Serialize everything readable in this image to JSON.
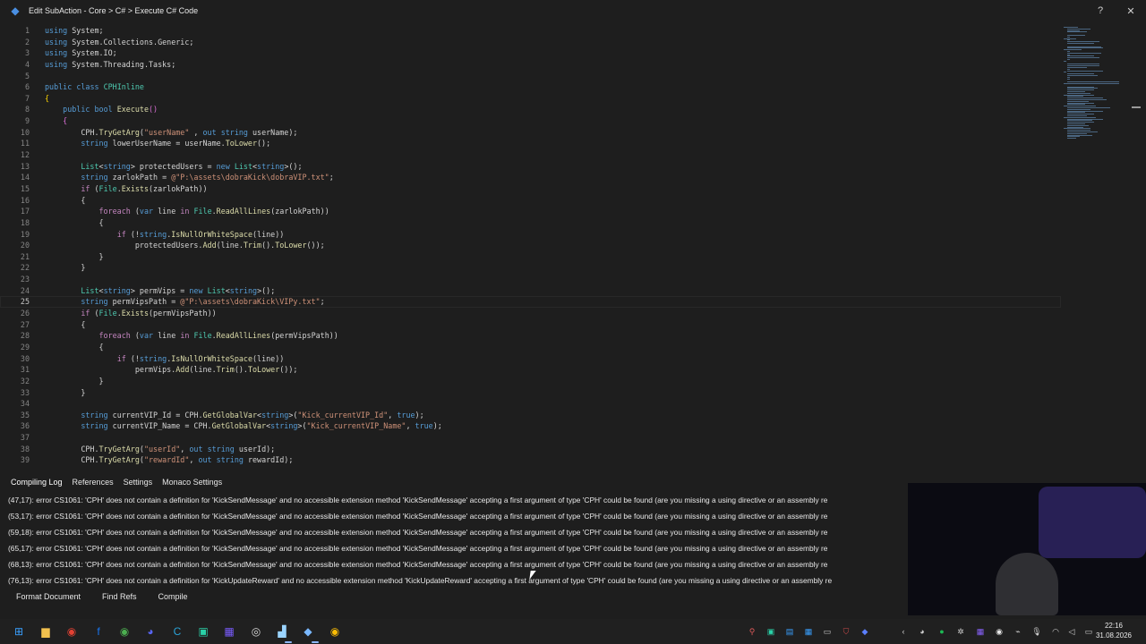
{
  "window": {
    "title": "Edit SubAction - Core > C# > Execute C# Code",
    "help_label": "?",
    "close_label": "✕"
  },
  "editor": {
    "current_line": 25,
    "lines": [
      {
        "n": "1",
        "tokens": [
          [
            "kw",
            "using"
          ],
          [
            "",
            "System;"
          ]
        ]
      },
      {
        "n": "2",
        "tokens": [
          [
            "kw",
            "using"
          ],
          [
            "",
            "System.Collections.Generic;"
          ]
        ]
      },
      {
        "n": "3",
        "tokens": [
          [
            "kw",
            "using"
          ],
          [
            "",
            "System.IO;"
          ]
        ]
      },
      {
        "n": "4",
        "tokens": [
          [
            "kw",
            "using"
          ],
          [
            "",
            "System.Threading.Tasks;"
          ]
        ]
      },
      {
        "n": "5",
        "tokens": []
      },
      {
        "n": "6",
        "tokens": [
          [
            "kw",
            "public"
          ],
          [
            "kw",
            "class"
          ],
          [
            "ty",
            "CPHInline"
          ]
        ]
      },
      {
        "n": "7",
        "tokens": [
          [
            "br",
            "{"
          ]
        ]
      },
      {
        "n": "8",
        "tokens": [
          [
            "",
            "    "
          ],
          [
            "kw",
            "public"
          ],
          [
            "kw",
            "bool"
          ],
          [
            "fn",
            "Execute"
          ],
          [
            "br2",
            "()"
          ]
        ]
      },
      {
        "n": "9",
        "tokens": [
          [
            "",
            "    "
          ],
          [
            "br2",
            "{"
          ]
        ]
      },
      {
        "n": "10",
        "tokens": [
          [
            "",
            "        CPH."
          ],
          [
            "fn",
            "TryGetArg"
          ],
          [
            "",
            "("
          ],
          [
            "st",
            "\"userName\""
          ],
          [
            "",
            " , "
          ],
          [
            "kw",
            "out"
          ],
          [
            "kw",
            "string"
          ],
          [
            "",
            "userName);"
          ]
        ]
      },
      {
        "n": "11",
        "tokens": [
          [
            "",
            "        "
          ],
          [
            "kw",
            "string"
          ],
          [
            "",
            "lowerUserName = userName."
          ],
          [
            "fn",
            "ToLower"
          ],
          [
            "",
            "();"
          ]
        ]
      },
      {
        "n": "12",
        "tokens": []
      },
      {
        "n": "13",
        "tokens": [
          [
            "",
            "        "
          ],
          [
            "ty",
            "List"
          ],
          [
            "",
            "<"
          ],
          [
            "kw",
            "string"
          ],
          [
            "",
            "> protectedUsers = "
          ],
          [
            "kw",
            "new"
          ],
          [
            "ty",
            "List"
          ],
          [
            "",
            "<"
          ],
          [
            "kw",
            "string"
          ],
          [
            "",
            ">();"
          ]
        ]
      },
      {
        "n": "14",
        "tokens": [
          [
            "",
            "        "
          ],
          [
            "kw",
            "string"
          ],
          [
            "",
            "zarlokPath = "
          ],
          [
            "st",
            "@\"P:\\assets\\dobraKick\\dobraVIP.txt\""
          ],
          [
            "",
            ";"
          ]
        ]
      },
      {
        "n": "15",
        "tokens": [
          [
            "",
            "        "
          ],
          [
            "cf",
            "if"
          ],
          [
            "",
            ""
          ],
          [
            "",
            "("
          ],
          [
            "ty",
            "File"
          ],
          [
            "",
            "."
          ],
          [
            "fn",
            "Exists"
          ],
          [
            "",
            "(zarlokPath))"
          ]
        ]
      },
      {
        "n": "16",
        "tokens": [
          [
            "",
            "        {"
          ]
        ]
      },
      {
        "n": "17",
        "tokens": [
          [
            "",
            "            "
          ],
          [
            "cf",
            "foreach"
          ],
          [
            "",
            ""
          ],
          [
            "",
            "("
          ],
          [
            "kw",
            "var"
          ],
          [
            "",
            "line "
          ],
          [
            "cf",
            "in"
          ],
          [
            "ty",
            "File"
          ],
          [
            "",
            "."
          ],
          [
            "fn",
            "ReadAllLines"
          ],
          [
            "",
            "(zarlokPath))"
          ]
        ]
      },
      {
        "n": "18",
        "tokens": [
          [
            "",
            "            {"
          ]
        ]
      },
      {
        "n": "19",
        "tokens": [
          [
            "",
            "                "
          ],
          [
            "cf",
            "if"
          ],
          [
            "",
            ""
          ],
          [
            "",
            "(!"
          ],
          [
            "kw",
            "string"
          ],
          [
            "",
            "."
          ],
          [
            "fn",
            "IsNullOrWhiteSpace"
          ],
          [
            "",
            "(line))"
          ]
        ]
      },
      {
        "n": "20",
        "tokens": [
          [
            "",
            "                    protectedUsers."
          ],
          [
            "fn",
            "Add"
          ],
          [
            "",
            "(line."
          ],
          [
            "fn",
            "Trim"
          ],
          [
            "",
            "()."
          ],
          [
            "fn",
            "ToLower"
          ],
          [
            "",
            "());"
          ]
        ]
      },
      {
        "n": "21",
        "tokens": [
          [
            "",
            "            }"
          ]
        ]
      },
      {
        "n": "22",
        "tokens": [
          [
            "",
            "        }"
          ]
        ]
      },
      {
        "n": "23",
        "tokens": []
      },
      {
        "n": "24",
        "tokens": [
          [
            "",
            "        "
          ],
          [
            "ty",
            "List"
          ],
          [
            "",
            "<"
          ],
          [
            "kw",
            "string"
          ],
          [
            "",
            "> permVips = "
          ],
          [
            "kw",
            "new"
          ],
          [
            "ty",
            "List"
          ],
          [
            "",
            "<"
          ],
          [
            "kw",
            "string"
          ],
          [
            "",
            ">();"
          ]
        ]
      },
      {
        "n": "25",
        "tokens": [
          [
            "",
            "        "
          ],
          [
            "kw",
            "string"
          ],
          [
            "",
            "permVipsPath = "
          ],
          [
            "st",
            "@\"P:\\assets\\dobraKick\\VIPy.txt\""
          ],
          [
            "",
            ";"
          ]
        ]
      },
      {
        "n": "26",
        "tokens": [
          [
            "",
            "        "
          ],
          [
            "cf",
            "if"
          ],
          [
            "",
            ""
          ],
          [
            "",
            "("
          ],
          [
            "ty",
            "File"
          ],
          [
            "",
            "."
          ],
          [
            "fn",
            "Exists"
          ],
          [
            "",
            "(permVipsPath))"
          ]
        ]
      },
      {
        "n": "27",
        "tokens": [
          [
            "",
            "        {"
          ]
        ]
      },
      {
        "n": "28",
        "tokens": [
          [
            "",
            "            "
          ],
          [
            "cf",
            "foreach"
          ],
          [
            "",
            ""
          ],
          [
            "",
            "("
          ],
          [
            "kw",
            "var"
          ],
          [
            "",
            "line "
          ],
          [
            "cf",
            "in"
          ],
          [
            "ty",
            "File"
          ],
          [
            "",
            "."
          ],
          [
            "fn",
            "ReadAllLines"
          ],
          [
            "",
            "(permVipsPath))"
          ]
        ]
      },
      {
        "n": "29",
        "tokens": [
          [
            "",
            "            {"
          ]
        ]
      },
      {
        "n": "30",
        "tokens": [
          [
            "",
            "                "
          ],
          [
            "cf",
            "if"
          ],
          [
            "",
            ""
          ],
          [
            "",
            "(!"
          ],
          [
            "kw",
            "string"
          ],
          [
            "",
            "."
          ],
          [
            "fn",
            "IsNullOrWhiteSpace"
          ],
          [
            "",
            "(line))"
          ]
        ]
      },
      {
        "n": "31",
        "tokens": [
          [
            "",
            "                    permVips."
          ],
          [
            "fn",
            "Add"
          ],
          [
            "",
            "(line."
          ],
          [
            "fn",
            "Trim"
          ],
          [
            "",
            "()."
          ],
          [
            "fn",
            "ToLower"
          ],
          [
            "",
            "());"
          ]
        ]
      },
      {
        "n": "32",
        "tokens": [
          [
            "",
            "            }"
          ]
        ]
      },
      {
        "n": "33",
        "tokens": [
          [
            "",
            "        }"
          ]
        ]
      },
      {
        "n": "34",
        "tokens": []
      },
      {
        "n": "35",
        "tokens": [
          [
            "",
            "        "
          ],
          [
            "kw",
            "string"
          ],
          [
            "",
            "currentVIP_Id = CPH."
          ],
          [
            "fn",
            "GetGlobalVar"
          ],
          [
            "",
            "<"
          ],
          [
            "kw",
            "string"
          ],
          [
            "",
            ">("
          ],
          [
            "st",
            "\"Kick_currentVIP_Id\""
          ],
          [
            "",
            ", "
          ],
          [
            "kw",
            "true"
          ],
          [
            "",
            ");"
          ]
        ]
      },
      {
        "n": "36",
        "tokens": [
          [
            "",
            "        "
          ],
          [
            "kw",
            "string"
          ],
          [
            "",
            "currentVIP_Name = CPH."
          ],
          [
            "fn",
            "GetGlobalVar"
          ],
          [
            "",
            "<"
          ],
          [
            "kw",
            "string"
          ],
          [
            "",
            ">("
          ],
          [
            "st",
            "\"Kick_currentVIP_Name\""
          ],
          [
            "",
            ", "
          ],
          [
            "kw",
            "true"
          ],
          [
            "",
            ");"
          ]
        ]
      },
      {
        "n": "37",
        "tokens": []
      },
      {
        "n": "38",
        "tokens": [
          [
            "",
            "        CPH."
          ],
          [
            "fn",
            "TryGetArg"
          ],
          [
            "",
            "("
          ],
          [
            "st",
            "\"userId\""
          ],
          [
            "",
            ", "
          ],
          [
            "kw",
            "out"
          ],
          [
            "kw",
            "string"
          ],
          [
            "",
            "userId);"
          ]
        ]
      },
      {
        "n": "39",
        "tokens": [
          [
            "",
            "        CPH."
          ],
          [
            "fn",
            "TryGetArg"
          ],
          [
            "",
            "("
          ],
          [
            "st",
            "\"rewardId\""
          ],
          [
            "",
            ", "
          ],
          [
            "kw",
            "out"
          ],
          [
            "kw",
            "string"
          ],
          [
            "",
            "rewardId);"
          ]
        ]
      }
    ]
  },
  "panel": {
    "tabs": [
      "Compiling Log",
      "References",
      "Settings",
      "Monaco Settings"
    ],
    "log": [
      "(47,17): error CS1061: 'CPH' does not contain a definition for 'KickSendMessage' and no accessible extension method 'KickSendMessage' accepting a first argument of type 'CPH' could be found (are you missing a using directive or an assembly re",
      "(53,17): error CS1061: 'CPH' does not contain a definition for 'KickSendMessage' and no accessible extension method 'KickSendMessage' accepting a first argument of type 'CPH' could be found (are you missing a using directive or an assembly re",
      "(59,18): error CS1061: 'CPH' does not contain a definition for 'KickSendMessage' and no accessible extension method 'KickSendMessage' accepting a first argument of type 'CPH' could be found (are you missing a using directive or an assembly re",
      "(65,17): error CS1061: 'CPH' does not contain a definition for 'KickSendMessage' and no accessible extension method 'KickSendMessage' accepting a first argument of type 'CPH' could be found (are you missing a using directive or an assembly re",
      "(68,13): error CS1061: 'CPH' does not contain a definition for 'KickSendMessage' and no accessible extension method 'KickSendMessage' accepting a first argument of type 'CPH' could be found (are you missing a using directive or an assembly re",
      "(76,13): error CS1061: 'CPH' does not contain a definition for 'KickUpdateReward' and no accessible extension method 'KickUpdateReward' accepting a first argument of type 'CPH' could be found (are you missing a using directive or an assembly re"
    ],
    "actions": [
      "Format Document",
      "Find Refs",
      "Compile"
    ]
  },
  "taskbar": {
    "items": [
      {
        "name": "windows-start-icon",
        "glyph": "⊞",
        "color": "#3aa0ff"
      },
      {
        "name": "file-explorer-icon",
        "glyph": "▆",
        "color": "#f2c14e"
      },
      {
        "name": "chrome-icon",
        "glyph": "◉",
        "color": "#e34133"
      },
      {
        "name": "facebook-icon",
        "glyph": "f",
        "color": "#1877f2"
      },
      {
        "name": "chrome-profile-icon",
        "glyph": "◉",
        "color": "#4caf50"
      },
      {
        "name": "discord-icon",
        "glyph": "◕",
        "color": "#5865f2"
      },
      {
        "name": "ccleaner-icon",
        "glyph": "C",
        "color": "#2aa3d8"
      },
      {
        "name": "editor-app-icon",
        "glyph": "▣",
        "color": "#2ad1a8"
      },
      {
        "name": "grid-app-icon",
        "glyph": "▦",
        "color": "#7a5cff"
      },
      {
        "name": "obs-icon",
        "glyph": "◎",
        "color": "#d9d9d9"
      },
      {
        "name": "streamerbot-icon",
        "glyph": "▟",
        "color": "#9ad4ff"
      },
      {
        "name": "streamerbot-active-icon",
        "glyph": "◆",
        "color": "#7ab8ff"
      },
      {
        "name": "chrome-alt-icon",
        "glyph": "◉",
        "color": "#fbbc05"
      }
    ],
    "tray": [
      {
        "name": "location-icon",
        "glyph": "⚲",
        "color": "#e05a5a"
      },
      {
        "name": "tray-app-icon-1",
        "glyph": "▣",
        "color": "#2ad1a8"
      },
      {
        "name": "tray-app-icon-2",
        "glyph": "▤",
        "color": "#39a0ff"
      },
      {
        "name": "tray-app-icon-3",
        "glyph": "▦",
        "color": "#39a0ff"
      },
      {
        "name": "tray-app-icon-4",
        "glyph": "▭",
        "color": "#cfcfcf"
      },
      {
        "name": "tray-shield-icon",
        "glyph": "⛉",
        "color": "#d24b4b"
      },
      {
        "name": "tray-app-icon-5",
        "glyph": "◆",
        "color": "#5b7fff"
      },
      {
        "name": "tray-arrow-icon",
        "glyph": "‹",
        "color": "#cfcfcf"
      },
      {
        "name": "tray-discord-icon",
        "glyph": "◕",
        "color": "#cfcfcf"
      },
      {
        "name": "spotify-icon",
        "glyph": "●",
        "color": "#1db954"
      },
      {
        "name": "tray-app-icon-6",
        "glyph": "✲",
        "color": "#cfcfcf"
      },
      {
        "name": "tray-app-icon-7",
        "glyph": "▦",
        "color": "#8a63ff"
      },
      {
        "name": "tray-app-icon-8",
        "glyph": "◉",
        "color": "#e8e8e8"
      },
      {
        "name": "usb-icon",
        "glyph": "⌁",
        "color": "#cfcfcf"
      },
      {
        "name": "microphone-icon",
        "glyph": "🎙",
        "color": "#cfcfcf"
      },
      {
        "name": "wifi-icon",
        "glyph": "◠",
        "color": "#cfcfcf"
      },
      {
        "name": "volume-icon",
        "glyph": "◁",
        "color": "#cfcfcf"
      },
      {
        "name": "keyboard-icon",
        "glyph": "▭",
        "color": "#cfcfcf"
      }
    ],
    "time": "22:16",
    "date": "31.08.2026"
  }
}
